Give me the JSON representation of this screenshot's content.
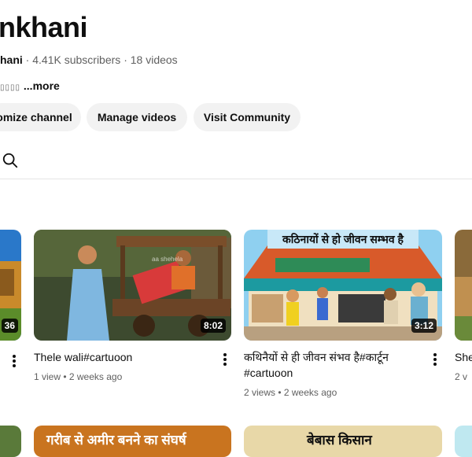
{
  "channel": {
    "name": "nkhani",
    "handle": "hani",
    "subscribers": "4.41K subscribers",
    "videos": "18 videos",
    "separator": "·",
    "description_glyphs": "▯▯▯▯",
    "more_label": "...more"
  },
  "actions": {
    "customize": "omize channel",
    "manage": "Manage videos",
    "community": "Visit Community"
  },
  "videos": [
    {
      "duration": "36"
    },
    {
      "title": "Thele wali#cartuoon",
      "meta": "1 view • 2 weeks ago",
      "duration": "8:02",
      "thumb_text": "aa shehela"
    },
    {
      "title": "कथिनैयों से ही जीवन संभव है#कार्टून #cartuoon",
      "meta": "2 views • 2 weeks ago",
      "duration": "3:12",
      "thumb_banner": "कठिनायों से हो जीवन सम्भव है"
    },
    {
      "title": "She",
      "meta": "2 v"
    }
  ],
  "second_row": [
    {
      "banner": "गरीब से अमीर बनने का संघर्ष"
    },
    {
      "banner": "बेबास किसान"
    }
  ],
  "colors": {
    "pill_bg": "#f2f2f2",
    "text_secondary": "#606060",
    "divider": "#e5e5e5"
  }
}
